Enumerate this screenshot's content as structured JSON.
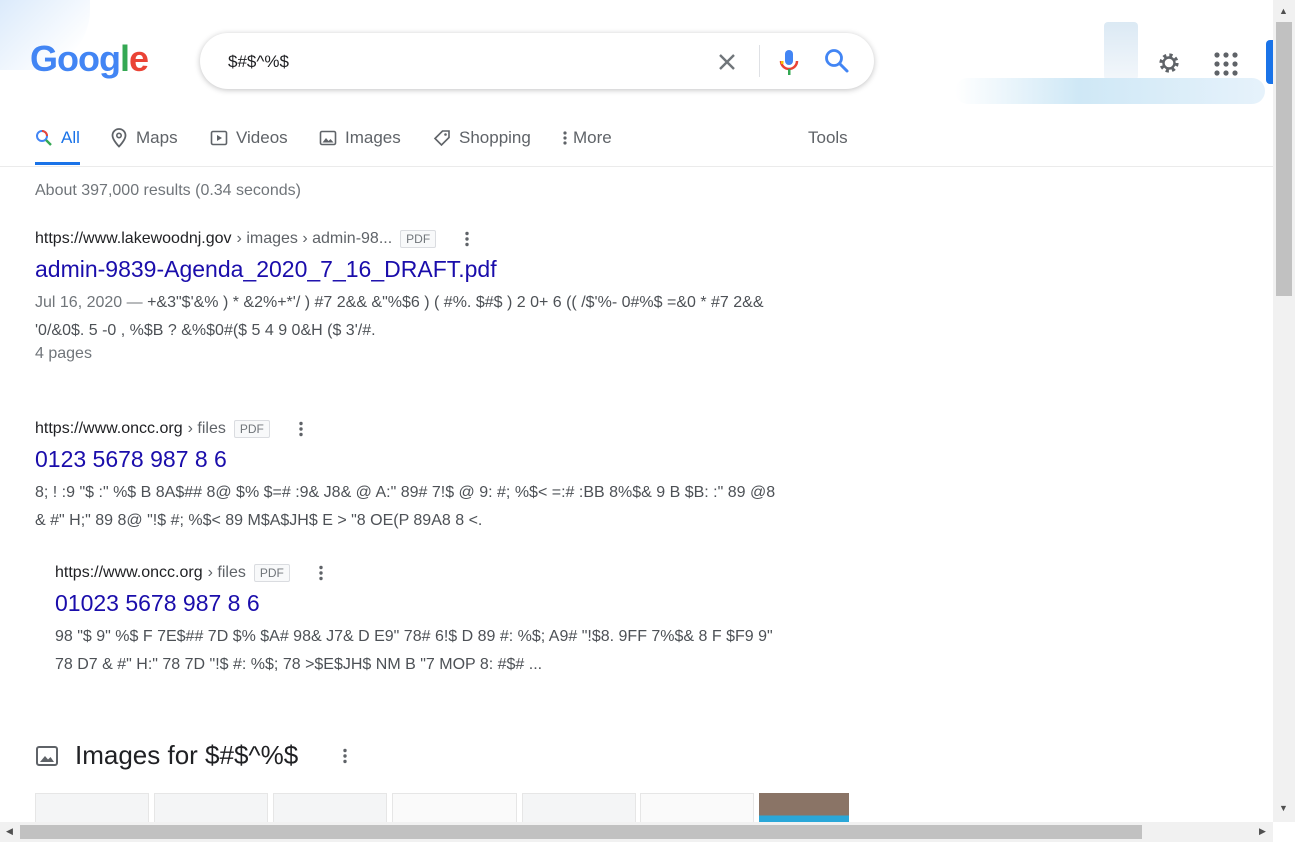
{
  "header": {
    "logo_text": "Google",
    "search_value": "$#$^%$"
  },
  "tabs": [
    {
      "label": "All",
      "icon": "search-icon",
      "active": true
    },
    {
      "label": "Maps",
      "icon": "map-pin-icon"
    },
    {
      "label": "Videos",
      "icon": "video-icon"
    },
    {
      "label": "Images",
      "icon": "image-icon"
    },
    {
      "label": "Shopping",
      "icon": "tag-icon"
    },
    {
      "label": "More",
      "icon": "more-vert-icon"
    }
  ],
  "tools_label": "Tools",
  "stats": "About 397,000 results (0.34 seconds)",
  "results": [
    {
      "domain": "https://www.lakewoodnj.gov",
      "path": "› images › admin-98...",
      "badge": "PDF",
      "title": "admin-9839-Agenda_2020_7_16_DRAFT.pdf",
      "date": "Jul 16, 2020 — ",
      "snippet": "+&3\"$'&% ) * &2%+*'/ ) #7 2&& &\"%$6 ) ( #%. $#$ ) 2 0+ 6 (( /$'%- 0#%$ =&0 * #7 2&& '0/&0$. 5 -0 , %$B ? &%$0#($ 5 4 9 0&H ($ 3'/#.",
      "pages": "4 pages"
    },
    {
      "domain": "https://www.oncc.org",
      "path": "› files",
      "badge": "PDF",
      "title": "0123 5678 987 8 6",
      "snippet": "8; ! :9 \"$ :\" %$ B 8A$## 8@ $% $=# :9& J8& @ A:\" 89# 7!$ @ 9: #; %$< =:# :BB 8%$& 9 B $B: :\" 89 @8 & #\" H;\" 89 8@ \"!$ #; %$< 89 M$A$JH$ E > \"8 OE(P 89A8 8 <."
    },
    {
      "domain": "https://www.oncc.org",
      "path": "› files",
      "badge": "PDF",
      "title": "01023 5678 987 8 6",
      "snippet": "98 \"$ 9\" %$ F 7E$## 7D $% $A# 98& J7& D E9\" 78# 6!$ D 89 #: %$; A9# \"!$8. 9FF 7%$& 8 F $F9 9\" 78 D7 & #\" H:\" 78 7D \"!$ #: %$; 78 >$E$JH$ NM B \"7 MOP 8: #$# ..."
    }
  ],
  "images_section": {
    "heading": "Images for $#$^%$"
  }
}
